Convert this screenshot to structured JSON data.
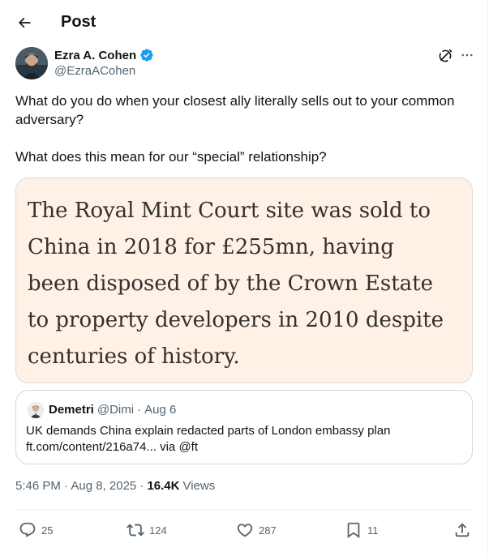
{
  "header": {
    "title": "Post"
  },
  "author": {
    "name": "Ezra A. Cohen",
    "handle": "@EzraACohen",
    "verified": true
  },
  "tweet": {
    "paragraphs": [
      "What do you do when your closest ally literally sells out to your common adversary?",
      "What does this mean for our “special” relationship?"
    ]
  },
  "media": {
    "text": "The Royal Mint Court site was sold to China in 2018 for £255mn, having been disposed of by the Crown Estate to property developers in 2010 despite centuries of history."
  },
  "quote": {
    "name": "Demetri",
    "handle": "@Dimi",
    "separator": "·",
    "date": "Aug 6",
    "line1": "UK demands China explain redacted parts of London embassy plan",
    "line2": "ft.com/content/216a74... via @ft"
  },
  "meta": {
    "time_date": "5:46 PM · Aug 8, 2025 ·",
    "views_count": "16.4K",
    "views_label": "Views"
  },
  "actions": {
    "replies": "25",
    "reposts": "124",
    "likes": "287",
    "bookmarks": "11"
  },
  "colors": {
    "verified": "#1d9bf0",
    "muted": "#536471",
    "media_bg": "#fff1e5"
  },
  "icons": [
    "back-arrow-icon",
    "verified-badge-icon",
    "grok-icon",
    "more-icon",
    "reply-icon",
    "repost-icon",
    "like-icon",
    "bookmark-icon",
    "share-icon"
  ]
}
